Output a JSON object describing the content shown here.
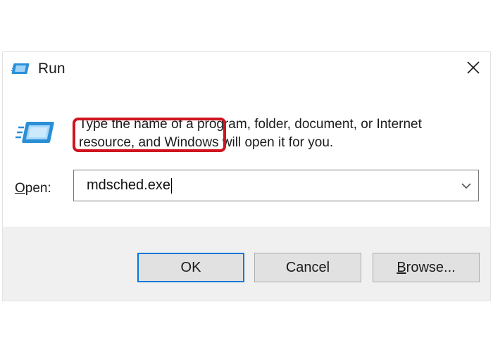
{
  "window": {
    "title": "Run",
    "title_icon": "run-app-icon",
    "close_icon": "close-icon"
  },
  "content": {
    "icon": "run-app-icon",
    "description": "Type the name of a program, folder, document, or Internet resource, and Windows will open it for you.",
    "open_label_mnemonic": "O",
    "open_label_rest": "pen:",
    "input_value": "mdsched.exe",
    "dropdown_icon": "chevron-down-icon"
  },
  "buttons": {
    "ok_label": "OK",
    "cancel_label": "Cancel",
    "browse_mnemonic": "B",
    "browse_rest": "rowse..."
  },
  "colors": {
    "highlight": "#d0141f",
    "ok_border": "#0078d7",
    "footer_bg": "#f0f0f0",
    "button_bg": "#e1e1e1"
  }
}
